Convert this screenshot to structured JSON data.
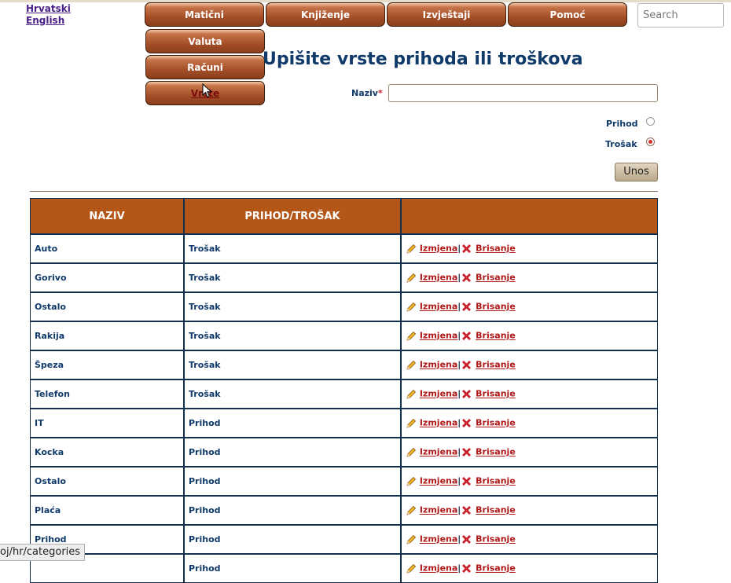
{
  "languages": [
    "Hrvatski",
    "English"
  ],
  "nav": {
    "top": [
      "Matični",
      "Knjiženje",
      "Izvještaji",
      "Pomoć"
    ],
    "submenu": [
      "Valuta",
      "Računi",
      "Vrste"
    ]
  },
  "search": {
    "placeholder": "Search"
  },
  "form": {
    "title": "Upišite vrste prihoda ili troškova",
    "name_label": "Naziv",
    "required_mark": "*",
    "name_value": "",
    "radio_income": "Prihod",
    "radio_expense": "Trošak",
    "selected": "Trošak",
    "submit": "Unos"
  },
  "table": {
    "headers": [
      "NAZIV",
      "PRIHOD/TROŠAK",
      ""
    ],
    "edit_label": "Izmjena",
    "delete_label": "Brisanje",
    "separator": "|",
    "rows": [
      {
        "name": "Auto",
        "type": "Trošak"
      },
      {
        "name": "Gorivo",
        "type": "Trošak"
      },
      {
        "name": "Ostalo",
        "type": "Trošak"
      },
      {
        "name": "Rakija",
        "type": "Trošak"
      },
      {
        "name": "Špeza",
        "type": "Trošak"
      },
      {
        "name": "Telefon",
        "type": "Trošak"
      },
      {
        "name": "IT",
        "type": "Prihod"
      },
      {
        "name": "Kocka",
        "type": "Prihod"
      },
      {
        "name": "Ostalo",
        "type": "Prihod"
      },
      {
        "name": "Plaća",
        "type": "Prihod"
      },
      {
        "name": "Prihod",
        "type": "Prihod"
      },
      {
        "name": "",
        "type": "Prihod"
      }
    ]
  },
  "status_url": "oj/hr/categories",
  "colors": {
    "nav_brown": "#a44f28",
    "header_brown": "#b35617",
    "title_blue": "#103a6a",
    "link_red": "#b01818",
    "radio_red": "#d2322a"
  }
}
